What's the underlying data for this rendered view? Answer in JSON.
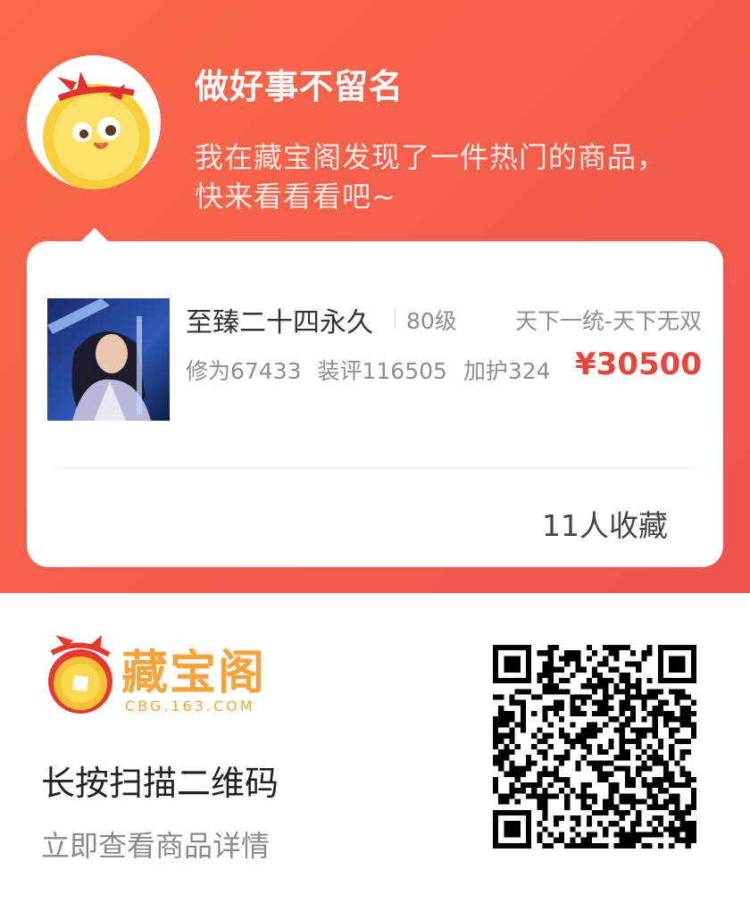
{
  "share": {
    "headline": "做好事不留名",
    "message": "我在藏宝阁发现了一件热门的商品，快来看看看吧~"
  },
  "item": {
    "name": "至臻二十四永久",
    "level": "80级",
    "server": "天下一统-天下无双",
    "stats": {
      "cultivation": "修为67433",
      "equipment_score": "装评116505",
      "protection": "加护324"
    },
    "price": "¥30500",
    "favorites": "11人收藏"
  },
  "footer": {
    "logo_text": "藏宝阁",
    "logo_url": "CBG.163.COM",
    "scan_title": "长按扫描二维码",
    "scan_subtitle": "立即查看商品详情"
  },
  "colors": {
    "header_bg": "#f45d4c",
    "price": "#e8453c",
    "logo": "#f6a43a"
  },
  "icons": {
    "avatar": "mascot-coin-icon",
    "logo": "cbg-coin-logo-icon",
    "qr": "qr-code"
  }
}
